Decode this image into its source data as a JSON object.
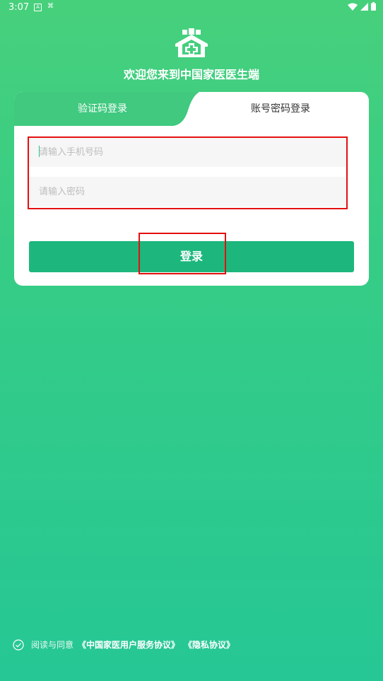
{
  "status_bar": {
    "time": "3:07",
    "notif_a": "A",
    "notif_b": "⌘"
  },
  "header": {
    "welcome": "欢迎您来到中国家医医生端"
  },
  "tabs": {
    "sms_login": "验证码登录",
    "password_login": "账号密码登录"
  },
  "form": {
    "phone_placeholder": "请输入手机号码",
    "password_placeholder": "请输入密码",
    "login_label": "登录"
  },
  "agreement": {
    "prefix": "阅读与同意",
    "service_link": "《中国家医用户服务协议》",
    "privacy_link": "《隐私协议》"
  },
  "colors": {
    "accent": "#1db77e",
    "highlight": "#e30f0f",
    "tab_inactive": "#40c97f"
  }
}
